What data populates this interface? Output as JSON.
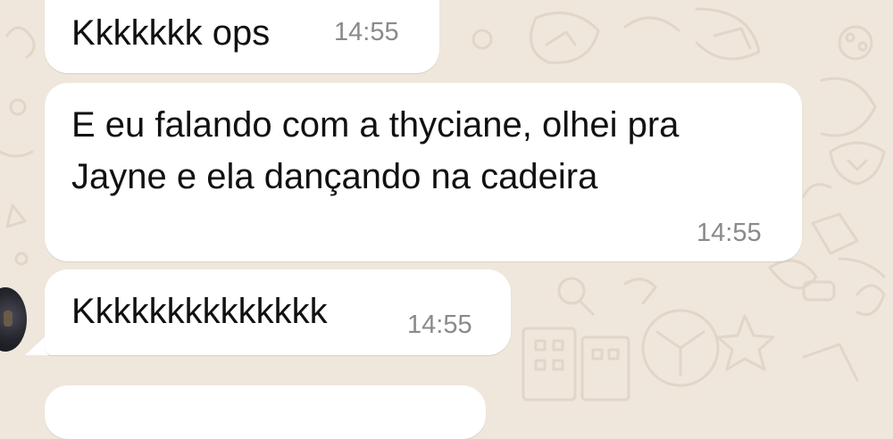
{
  "theme": {
    "background": "#efe7dc",
    "bubble": "#ffffff",
    "text": "#111111",
    "time": "#8a8a8a"
  },
  "messages": [
    {
      "text": "Kkkkkkk ops",
      "time": "14:55"
    },
    {
      "text_lines": [
        "E eu falando com a thyciane, olhei pra",
        "Jayne e ela dançando na cadeira"
      ],
      "time": "14:55"
    },
    {
      "text": "Kkkkkkkkkkkkkk",
      "time": "14:55"
    }
  ],
  "sender": {
    "avatar_icon": "profile-photo-avatar"
  }
}
